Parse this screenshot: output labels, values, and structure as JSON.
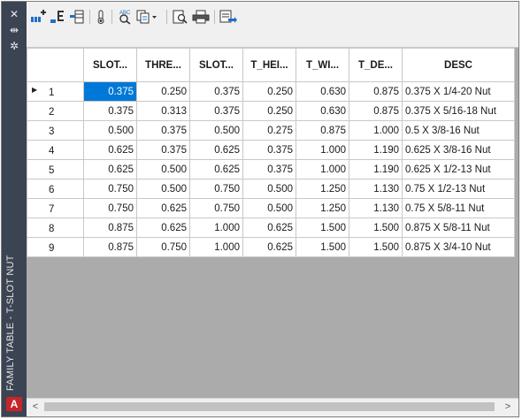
{
  "window": {
    "title": "FAMILY TABLE - T-SLOT NUT",
    "close_glyph": "✕",
    "autohide_glyph": "⇹",
    "properties_glyph": "✲",
    "app_logo": "A"
  },
  "toolbar": {
    "icons": [
      "insert-column-icon",
      "insert-row-icon",
      "add-rows-from-file-icon",
      "temperature-icon",
      "spell-check-icon",
      "find-icon",
      "copy-dropdown-icon",
      "preview-icon",
      "print-icon",
      "export-icon"
    ]
  },
  "table": {
    "columns": [
      "",
      "SLOT...",
      "THRE...",
      "SLOT...",
      "T_HEI...",
      "T_WI...",
      "T_DE...",
      "DESC"
    ],
    "active_row_marker": "▶",
    "rows": [
      {
        "num": "1",
        "cells": [
          "0.375",
          "0.250",
          "0.375",
          "0.250",
          "0.630",
          "0.875",
          "0.375 X 1/4-20 Nut"
        ]
      },
      {
        "num": "2",
        "cells": [
          "0.375",
          "0.313",
          "0.375",
          "0.250",
          "0.630",
          "0.875",
          "0.375 X 5/16-18 Nut"
        ]
      },
      {
        "num": "3",
        "cells": [
          "0.500",
          "0.375",
          "0.500",
          "0.275",
          "0.875",
          "1.000",
          "0.5 X 3/8-16 Nut"
        ]
      },
      {
        "num": "4",
        "cells": [
          "0.625",
          "0.375",
          "0.625",
          "0.375",
          "1.000",
          "1.190",
          "0.625 X 3/8-16 Nut"
        ]
      },
      {
        "num": "5",
        "cells": [
          "0.625",
          "0.500",
          "0.625",
          "0.375",
          "1.000",
          "1.190",
          "0.625 X 1/2-13 Nut"
        ]
      },
      {
        "num": "6",
        "cells": [
          "0.750",
          "0.500",
          "0.750",
          "0.500",
          "1.250",
          "1.130",
          "0.75 X 1/2-13 Nut"
        ]
      },
      {
        "num": "7",
        "cells": [
          "0.750",
          "0.625",
          "0.750",
          "0.500",
          "1.250",
          "1.130",
          "0.75 X 5/8-11 Nut"
        ]
      },
      {
        "num": "8",
        "cells": [
          "0.875",
          "0.625",
          "1.000",
          "0.625",
          "1.500",
          "1.500",
          "0.875 X 5/8-11 Nut"
        ]
      },
      {
        "num": "9",
        "cells": [
          "0.875",
          "0.750",
          "1.000",
          "0.625",
          "1.500",
          "1.500",
          "0.875 X 3/4-10 Nut"
        ]
      }
    ]
  },
  "scrollbar": {
    "left_arrow": "<",
    "right_arrow": ">"
  },
  "colors": {
    "strip": "#3b4453",
    "selection": "#0078d7",
    "empty_area": "#ababab"
  }
}
